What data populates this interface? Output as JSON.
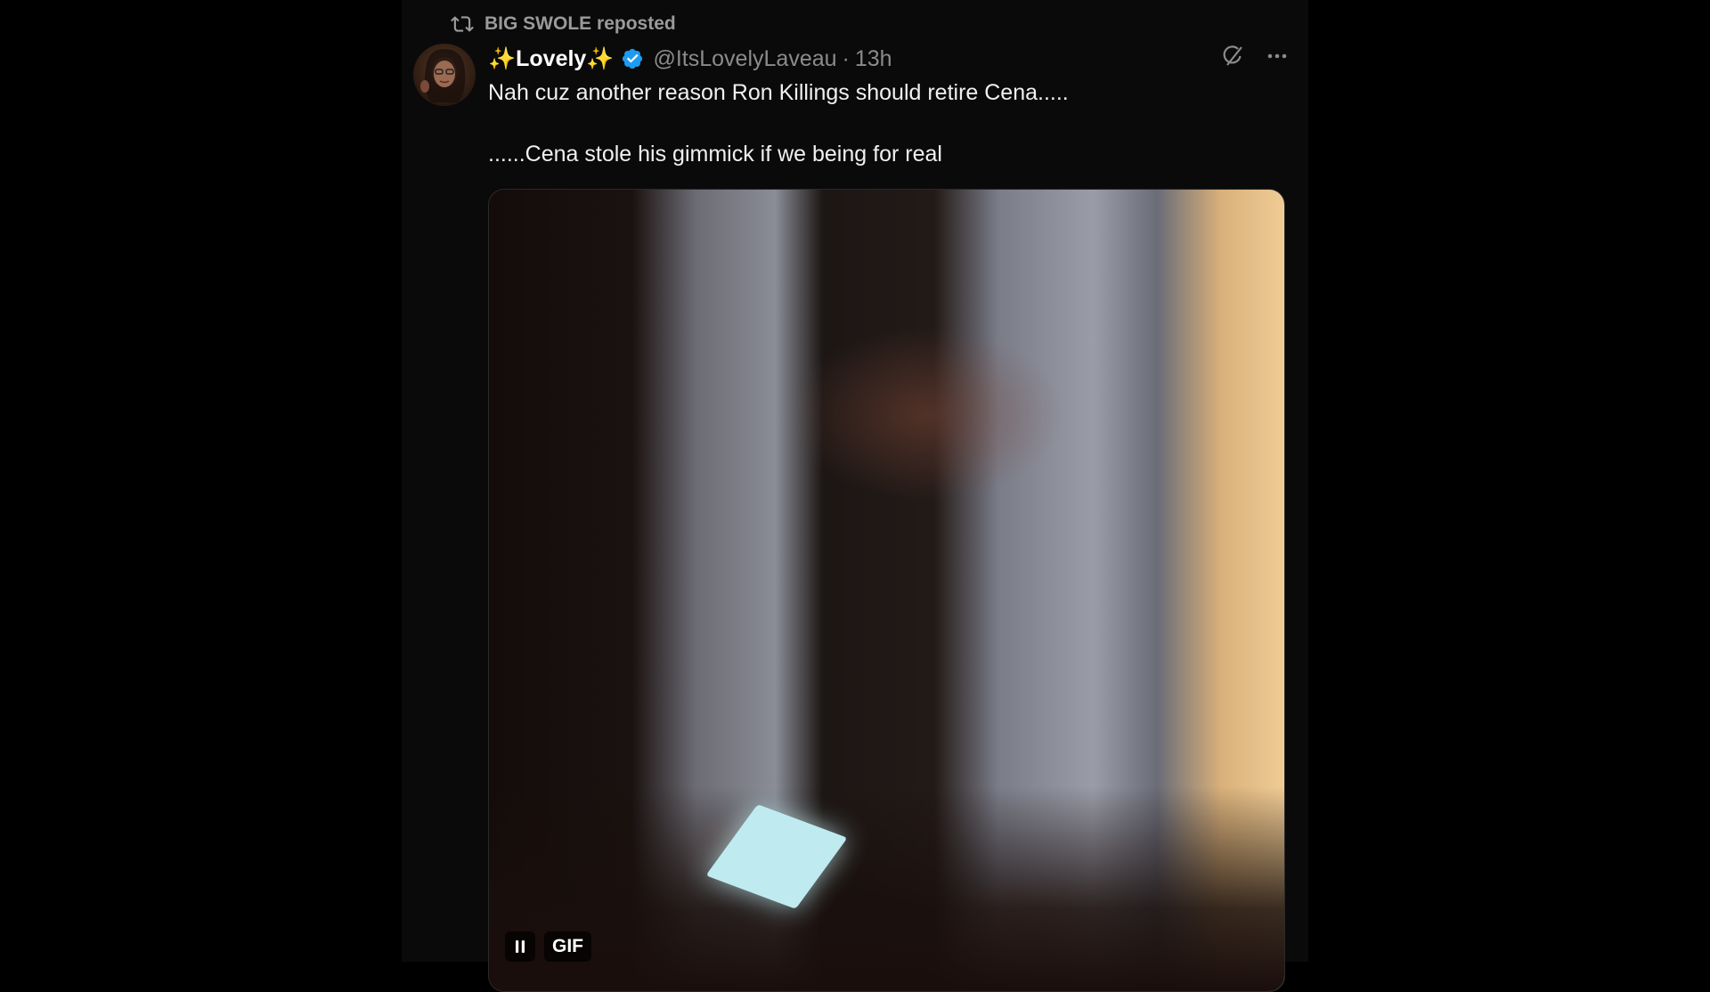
{
  "repost": {
    "reposter": "BIG SWOLE",
    "verb": "reposted",
    "icon": "repost-icon"
  },
  "post": {
    "display_name": {
      "prefix_emoji": "✨",
      "name": "Lovely",
      "suffix_emoji": "✨"
    },
    "verified": true,
    "handle": "@ItsLovelyLaveau",
    "separator": "·",
    "time": "13h",
    "text_lines": [
      "Nah cuz another reason Ron Killings should retire Cena.....",
      "......Cena stole his gimmick if we being for real"
    ],
    "actions": {
      "grok_icon": "grok-icon",
      "more_icon": "more-icon"
    },
    "media": {
      "type": "gif",
      "badge": "GIF",
      "pause_icon": "pause-icon"
    }
  },
  "colors": {
    "background": "#000000",
    "column": "#0a0a0a",
    "muted_text": "#8b8b8b",
    "verified_blue": "#1d9bf0"
  }
}
